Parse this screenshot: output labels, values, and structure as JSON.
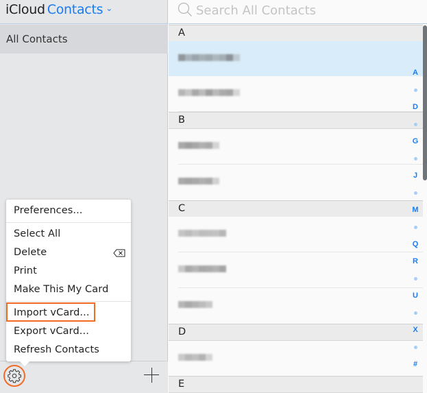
{
  "header": {
    "brand": "iCloud",
    "app_name": "Contacts",
    "app_chevron_icon": "chevron-down-icon"
  },
  "sidebar": {
    "groups": [
      {
        "label": "All Contacts",
        "selected": true
      }
    ],
    "footer": {
      "settings_icon": "gear-icon",
      "add_icon": "plus-icon"
    }
  },
  "menu": {
    "items": [
      {
        "label": "Preferences..."
      },
      {
        "label": "Select All"
      },
      {
        "label": "Delete",
        "shortcut_icon": "delete-key-icon"
      },
      {
        "label": "Print"
      },
      {
        "label": "Make This My Card"
      },
      {
        "label": "Import vCard...",
        "highlighted": true
      },
      {
        "label": "Export vCard..."
      },
      {
        "label": "Refresh Contacts"
      }
    ]
  },
  "search": {
    "placeholder": "Search All Contacts",
    "value": ""
  },
  "contacts": {
    "sections": [
      {
        "letter": "A",
        "count": 2
      },
      {
        "letter": "B",
        "count": 2
      },
      {
        "letter": "C",
        "count": 3
      },
      {
        "letter": "D",
        "count": 1
      },
      {
        "letter": "E",
        "count": 0
      }
    ],
    "name_note": "Contact names are blurred/pixelated in the screenshot",
    "selected_row": 0
  },
  "index": [
    "A",
    "•",
    "D",
    "•",
    "G",
    "•",
    "J",
    "•",
    "M",
    "•",
    "Q",
    "R",
    "•",
    "U",
    "•",
    "X",
    "•",
    "#"
  ],
  "colors": {
    "accent": "#1a7cf0",
    "highlight_annotation": "#f36b25",
    "selected_row": "#d9ecf9"
  }
}
